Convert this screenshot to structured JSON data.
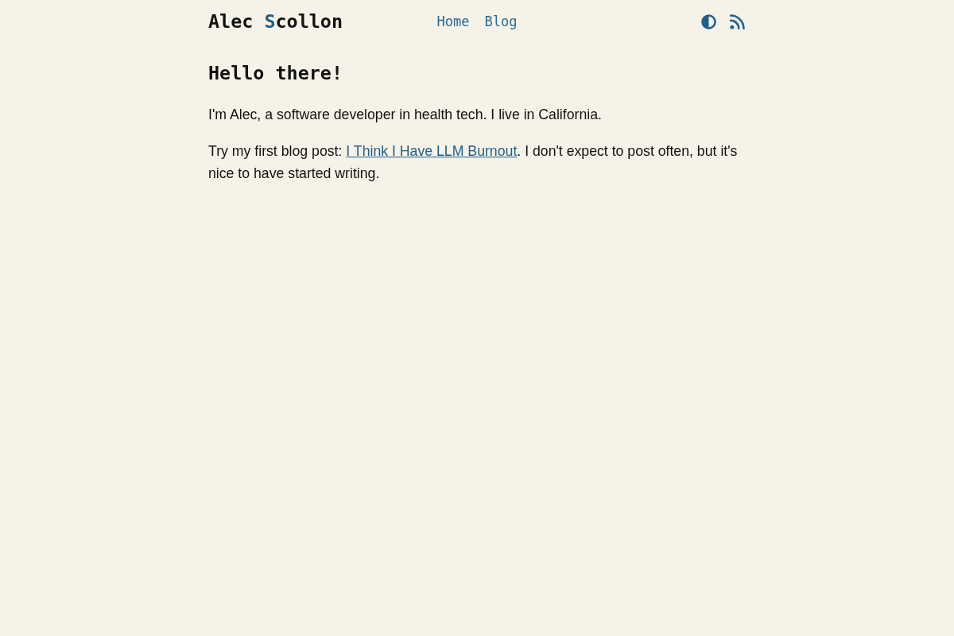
{
  "header": {
    "logo": [
      {
        "text": "Alec ",
        "accent": false
      },
      {
        "text": "S",
        "accent": true
      },
      {
        "text": "collon",
        "accent": false
      }
    ],
    "nav": [
      {
        "label": "Home"
      },
      {
        "label": "Blog"
      }
    ]
  },
  "content": {
    "heading": "Hello there!",
    "paragraphs": [
      [
        {
          "kind": "text",
          "text": "I'm Alec, a software developer in health tech. I live in California."
        }
      ],
      [
        {
          "kind": "text",
          "text": "Try my first blog post: "
        },
        {
          "kind": "link",
          "text": "I Think I Have LLM Burnout"
        },
        {
          "kind": "text",
          "text": ". I don't expect to post often, but it's nice to have started writing."
        }
      ]
    ]
  }
}
